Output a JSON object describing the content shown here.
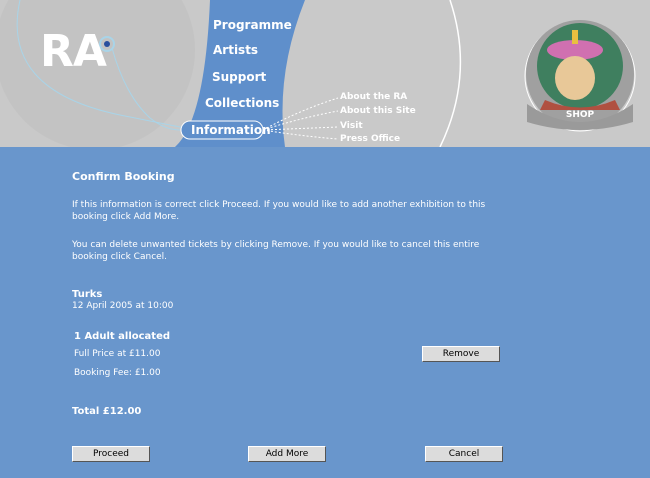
{
  "header": {
    "logo": "RA",
    "nav": [
      {
        "label": "Programme"
      },
      {
        "label": "Artists"
      },
      {
        "label": "Support"
      },
      {
        "label": "Collections"
      },
      {
        "label": "Information",
        "active": true
      }
    ],
    "subnav": [
      {
        "label": "About the RA"
      },
      {
        "label": "About this Site"
      },
      {
        "label": "Visit"
      },
      {
        "label": "Press Office"
      }
    ],
    "shop_label": "SHOP"
  },
  "main": {
    "title": "Confirm Booking",
    "intro_1": "If this information is correct click Proceed. If you would like to add another exhibition to this booking click Add More.",
    "intro_2": "You can delete unwanted tickets by clicking Remove. If you would like to cancel this entire booking click Cancel.",
    "exhibition": {
      "name": "Turks",
      "date": "12 April 2005 at 10:00"
    },
    "tickets": {
      "allocated": "1 Adult allocated",
      "full_price": "Full Price at £11.00",
      "booking_fee": "Booking Fee: £1.00"
    },
    "total": "Total £12.00"
  },
  "buttons": {
    "remove": "Remove",
    "proceed": "Proceed",
    "add_more": "Add More",
    "cancel": "Cancel"
  },
  "colors": {
    "background": "#6996cc",
    "header_bg": "#c9c9c9",
    "nav_band": "#5f8fcb"
  }
}
